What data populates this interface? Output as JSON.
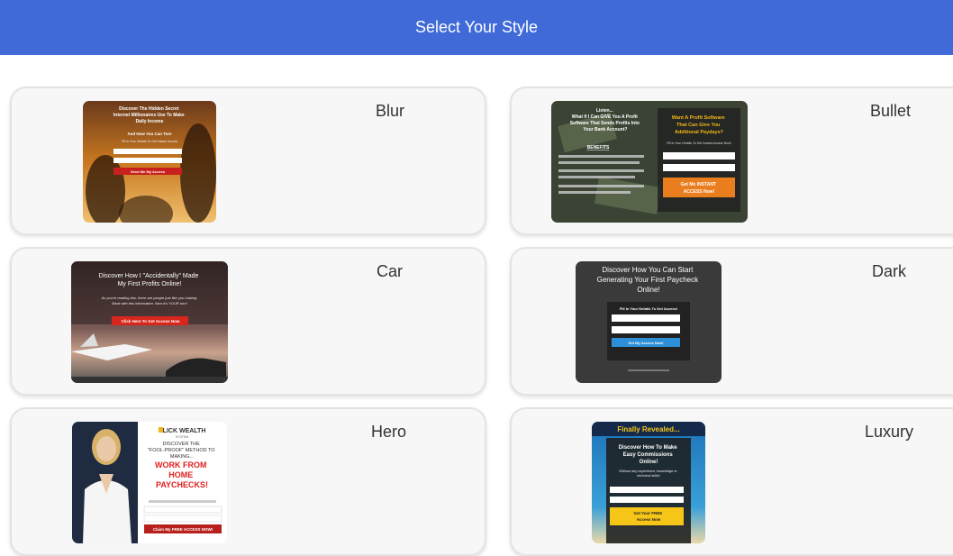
{
  "header": {
    "title": "Select Your Style"
  },
  "styles": [
    {
      "name": "Blur",
      "thumb": {
        "headline": "Discover The Hidden Secret Internet Millionaires Use To Make Daily Income",
        "sub": "And How You Can Too!",
        "note": "Fill in Your Details To Get Instant Access",
        "button": "Send Me My Access"
      }
    },
    {
      "name": "Bullet",
      "thumb": {
        "headline": "Listen... What If I Can GIVE You A Profit Software That Sends Profits Into Your Bank Account?",
        "benefits": "BENEFITS",
        "right_title": "Want A Profit Software That Can Give You Additional Paydays?",
        "right_note": "Fill in Your Details To Get Instant Access Now!",
        "button": "Get Me INSTANT ACCESS Now!"
      }
    },
    {
      "name": "Car",
      "thumb": {
        "headline": "Discover How I \"Accidentally\" Made My First Profits Online!",
        "sub": "As you're reading this, there are people just like you making Bank with this information. Now it's YOUR turn!",
        "button": "Click Here To Get Access Now"
      }
    },
    {
      "name": "Dark",
      "thumb": {
        "headline": "Discover How You Can Start Generating Your First Paycheck Online!",
        "note": "Fill In Your Details To Get Access!",
        "button": "Get My Access Now!"
      }
    },
    {
      "name": "Hero",
      "thumb": {
        "logo": "CLICK WEALTH",
        "logo_sub": "SYSTEM",
        "sub": "DISCOVER THE \"FOOL-PROOF\" METHOD TO MAKING...",
        "headline": "WORK FROM HOME PAYCHECKS!",
        "button": "Claim My FREE ACCESS NOW!"
      }
    },
    {
      "name": "Luxury",
      "thumb": {
        "banner": "Finally Revealed...",
        "headline": "Discover How To Make Easy Commissions Online!",
        "sub": "Without any experience, knowledge or technical skills!",
        "button": "Get Your FREE Access Now"
      }
    }
  ],
  "colors": {
    "header": "#3f6ad8",
    "card_bg": "#f7f7f7",
    "card_border": "#e3e3e3",
    "label": "#333333"
  }
}
